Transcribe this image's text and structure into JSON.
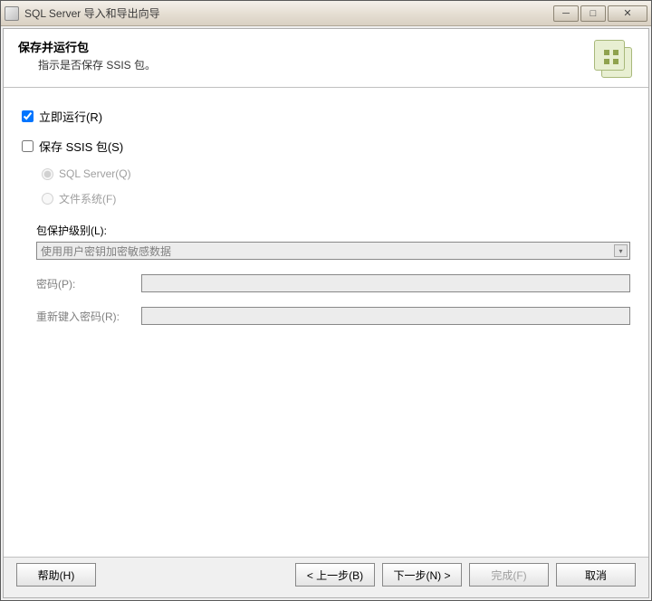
{
  "window": {
    "title": "SQL Server 导入和导出向导"
  },
  "header": {
    "title": "保存并运行包",
    "subtitle": "指示是否保存 SSIS 包。"
  },
  "options": {
    "run_immediately": "立即运行(R)",
    "save_ssis": "保存 SSIS 包(S)",
    "sql_server": "SQL Server(Q)",
    "file_system": "文件系统(F)"
  },
  "protection": {
    "label": "包保护级别(L):",
    "value": "使用用户密钥加密敏感数据"
  },
  "password": {
    "label": "密码(P):",
    "retype_label": "重新键入密码(R):"
  },
  "buttons": {
    "help": "帮助(H)",
    "back": "< 上一步(B)",
    "next": "下一步(N) >",
    "finish": "完成(F)",
    "cancel": "取消"
  }
}
